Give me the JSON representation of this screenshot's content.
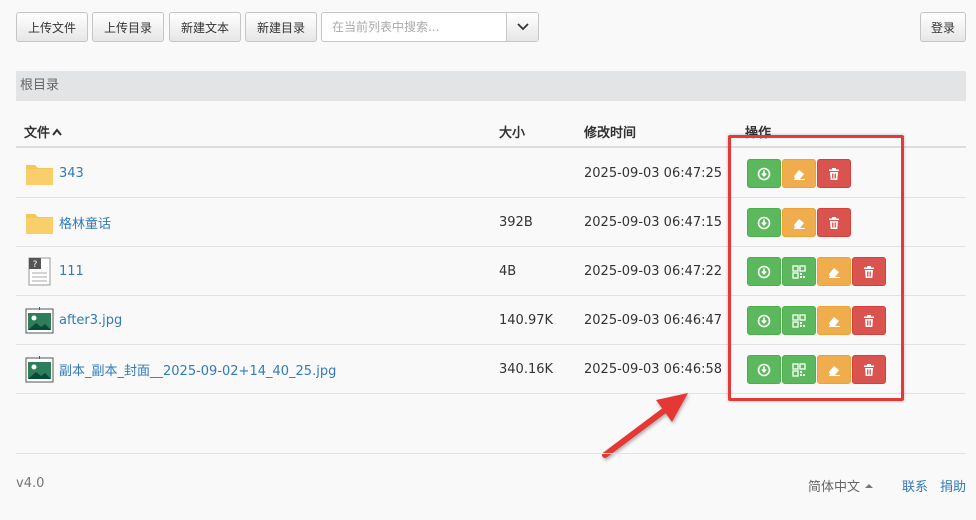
{
  "toolbar": {
    "upload_file_label": "上传文件",
    "upload_dir_label": "上传目录",
    "new_text_label": "新建文本",
    "new_dir_label": "新建目录",
    "search_placeholder": "在当前列表中搜索...",
    "login_label": "登录"
  },
  "breadcrumb": {
    "root": "根目录"
  },
  "table": {
    "headers": {
      "file": "文件",
      "size": "大小",
      "mtime": "修改时间",
      "actions": "操作"
    },
    "rows": [
      {
        "name": "343",
        "type": "folder-icon",
        "size": "",
        "mtime": "2025-09-03 06:47:25",
        "actions": [
          "download",
          "rename",
          "delete"
        ]
      },
      {
        "name": "格林童话",
        "type": "folder-icon",
        "size": "392B",
        "mtime": "2025-09-03 06:47:15",
        "actions": [
          "download",
          "rename",
          "delete"
        ]
      },
      {
        "name": "111",
        "type": "unknown-file-icon",
        "size": "4B",
        "mtime": "2025-09-03 06:47:22",
        "actions": [
          "download",
          "qrcode",
          "rename",
          "delete"
        ]
      },
      {
        "name": "after3.jpg",
        "type": "image-file-icon",
        "size": "140.97K",
        "mtime": "2025-09-03 06:46:47",
        "actions": [
          "download",
          "qrcode",
          "rename",
          "delete"
        ]
      },
      {
        "name": "副本_副本_封面__2025-09-02+14_40_25.jpg",
        "type": "image-file-icon",
        "size": "340.16K",
        "mtime": "2025-09-03 06:46:58",
        "actions": [
          "download",
          "qrcode",
          "rename",
          "delete"
        ]
      }
    ]
  },
  "footer": {
    "version": "v4.0",
    "language": "简体中文",
    "contact": "联系",
    "donate": "捐助"
  },
  "colors": {
    "download": "#5cb85c",
    "qrcode": "#5cb85c",
    "rename": "#f0ad4e",
    "delete": "#d9534f",
    "link": "#337ab7",
    "annotation": "#e53935"
  }
}
